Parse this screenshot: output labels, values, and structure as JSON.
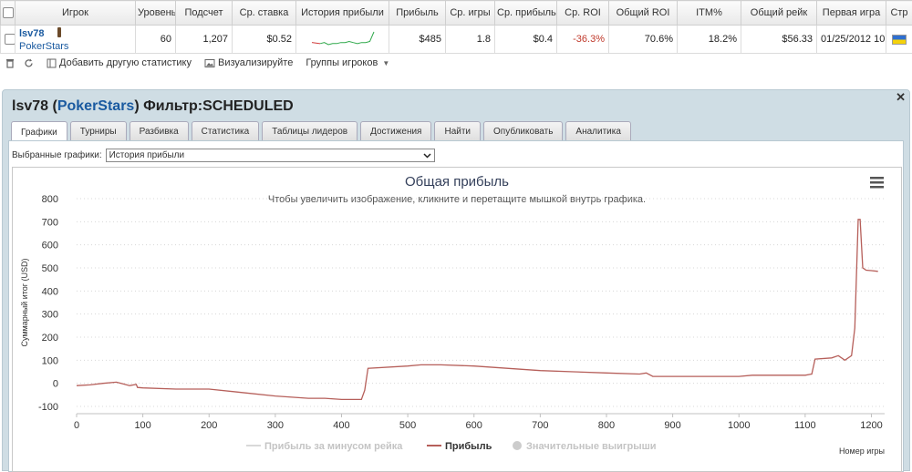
{
  "table": {
    "headers": [
      "Игрок",
      "Уровень",
      "Подсчет",
      "Ср. ставка",
      "История прибыли",
      "Прибыль",
      "Ср. игры",
      "Ср. прибыль",
      "Ср. ROI",
      "Общий ROI",
      "ITM%",
      "Общий рейк",
      "Первая игра",
      "Стр"
    ],
    "row": {
      "player": "lsv78",
      "site": "PokerStars",
      "level": "60",
      "count": "1,207",
      "avg_stake": "$0.52",
      "profit": "$485",
      "avg_games": "1.8",
      "avg_profit": "$0.4",
      "avg_roi": "-36.3%",
      "total_roi": "70.6%",
      "itm": "18.2%",
      "total_rake": "$56.33",
      "first_game": "01/25/2012 10"
    },
    "sparkline": [
      10,
      9,
      9,
      10,
      8,
      9,
      9,
      10,
      10,
      11,
      10,
      9,
      10,
      10,
      11,
      20
    ]
  },
  "toolbar": {
    "add_stats": "Добавить другую статистику",
    "visualize": "Визуализируйте",
    "player_groups": "Группы игроков"
  },
  "panel": {
    "player": "lsv78",
    "site": "PokerStars",
    "filter": "Фильтр:SCHEDULED",
    "tabs": [
      "Графики",
      "Турниры",
      "Разбивка",
      "Статистика",
      "Таблицы лидеров",
      "Достижения",
      "Найти",
      "Опубликовать",
      "Аналитика"
    ],
    "select_label": "Выбранные графики:",
    "select_value": "История прибыли"
  },
  "colors": {
    "profit_line": "#b65f5a",
    "rake_line": "#d9d9d9",
    "sparkline_up": "#2ea84a",
    "sparkline_down": "#d03c3c",
    "title": "#333f5a"
  },
  "chart_data": {
    "type": "line",
    "title": "Общая прибыль",
    "subtitle": "Чтобы увеличить изображение, кликните и перетащите мышкой внутрь графика.",
    "xlabel": "Номер игры",
    "ylabel": "Суммарный итог (USD)",
    "xlim": [
      0,
      1220
    ],
    "ylim": [
      -100,
      800
    ],
    "xticks": [
      0,
      100,
      200,
      300,
      400,
      500,
      600,
      700,
      800,
      900,
      1000,
      1100,
      1200
    ],
    "yticks": [
      -100,
      0,
      100,
      200,
      300,
      400,
      500,
      600,
      700,
      800
    ],
    "grid": true,
    "legend_placement": "bottom",
    "legend": [
      "Прибыль за минусом рейка",
      "Прибыль",
      "Значительные выигрыши"
    ],
    "series": [
      {
        "name": "Прибыль",
        "x": [
          0,
          20,
          40,
          60,
          70,
          80,
          90,
          92,
          100,
          150,
          200,
          250,
          300,
          350,
          375,
          400,
          430,
          435,
          440,
          500,
          520,
          550,
          600,
          650,
          700,
          750,
          800,
          850,
          860,
          870,
          900,
          950,
          1000,
          1020,
          1100,
          1110,
          1115,
          1140,
          1150,
          1160,
          1170,
          1175,
          1180,
          1183,
          1187,
          1192,
          1200,
          1210
        ],
        "values": [
          -10,
          -7,
          0,
          5,
          -2,
          -10,
          -5,
          -18,
          -20,
          -25,
          -25,
          -40,
          -55,
          -65,
          -65,
          -70,
          -70,
          -30,
          65,
          75,
          80,
          80,
          75,
          65,
          55,
          50,
          45,
          40,
          45,
          30,
          30,
          30,
          30,
          35,
          35,
          40,
          105,
          110,
          120,
          100,
          120,
          240,
          710,
          710,
          500,
          490,
          488,
          485
        ]
      }
    ]
  }
}
